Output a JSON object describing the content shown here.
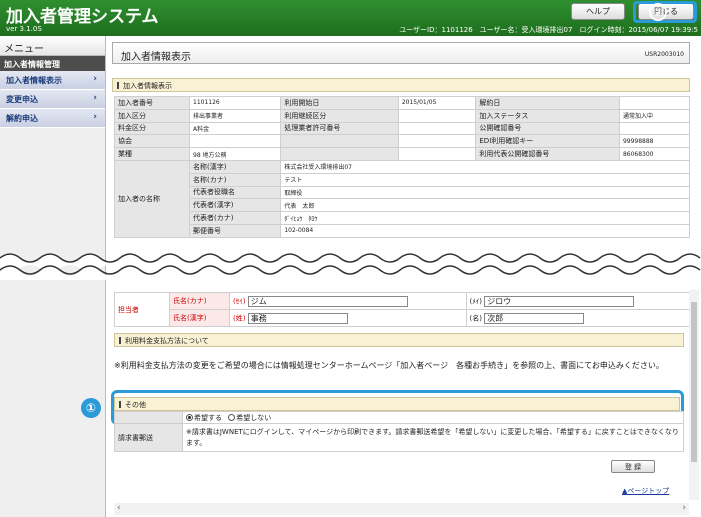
{
  "header": {
    "title": "加入者管理システム",
    "version": "ver 3.1.0S",
    "help_label": "ヘルプ",
    "close_label": "閉じる",
    "user_info": "ユーザーID：1101126　ユーザー名：受入環境排出07　ログイン時刻：2015/06/07 19:39:5"
  },
  "sidebar": {
    "header": "メニュー",
    "section": "加入者情報管理",
    "items": [
      {
        "label": "加入者情報表示",
        "chevron": "›"
      },
      {
        "label": "変更申込",
        "chevron": "›"
      },
      {
        "label": "解約申込",
        "chevron": "›"
      }
    ]
  },
  "page": {
    "title": "加入者情報表示",
    "screen_id": "USR2003010"
  },
  "sections": {
    "info": "加入者情報表示",
    "payment": "利用料金支払方法について",
    "other": "その他"
  },
  "info_rows": [
    [
      "加入者番号",
      "1101126",
      "利用開始日",
      "2015/01/05",
      "解約日",
      ""
    ],
    [
      "加入区分",
      "排出事業者",
      "利用継続区分",
      "",
      "加入ステータス",
      "通常加入中"
    ],
    [
      "料金区分",
      "A料金",
      "処理業者許可番号",
      "",
      "公開確認番号",
      ""
    ],
    [
      "協会",
      "",
      "",
      "",
      "EDI利用確認キー",
      "99998888"
    ],
    [
      "業種",
      "98 地方公務",
      "",
      "",
      "利用代表公開確認番号",
      "86068300"
    ]
  ],
  "name_block": {
    "label": "加入者の名称",
    "rows": [
      [
        "名称(漢字)",
        "株式会社受入環境排出07"
      ],
      [
        "名称(カナ)",
        "テスト"
      ],
      [
        "代表者役職名",
        "取締役"
      ],
      [
        "代表者(漢字)",
        "代表　太郎"
      ],
      [
        "代表者(カナ)",
        "ﾀﾞｲﾋｮｳ　ﾀﾛｳ"
      ],
      [
        "郵便番号",
        "102-0084"
      ]
    ]
  },
  "contact": {
    "label": "担当者",
    "kana_label": "氏名(カナ)",
    "kanji_label": "氏名(漢字)",
    "sei_kana_prefix": "(ｾｲ)",
    "sei_kana": "ジム",
    "mei_kana_prefix": "(ﾒｲ)",
    "mei_kana": "ジロウ",
    "sei_kanji_prefix": "(姓)",
    "sei_kanji": "事務",
    "mei_kanji_prefix": "(名)",
    "mei_kanji": "次郎"
  },
  "payment_note": "※利用料金支払方法の変更をご希望の場合には情報処理センターホームページ「加入者ページ　各種お手続き」を参照の上、書面にてお申込みください。",
  "other": {
    "radio_yes": "希望する",
    "radio_no": "希望しない",
    "mail_label": "請求書郵送",
    "mail_note": "※請求書はJWNETにログインして、マイページから印刷できます。請求書郵送希望を「希望しない」に変更した場合、「希望する」に戻すことはできなくなります。"
  },
  "register_label": "登 録",
  "pagetop_label": "▲ページトップ",
  "callouts": {
    "one": "①",
    "two": "②"
  },
  "accent": "#2a9ad8"
}
